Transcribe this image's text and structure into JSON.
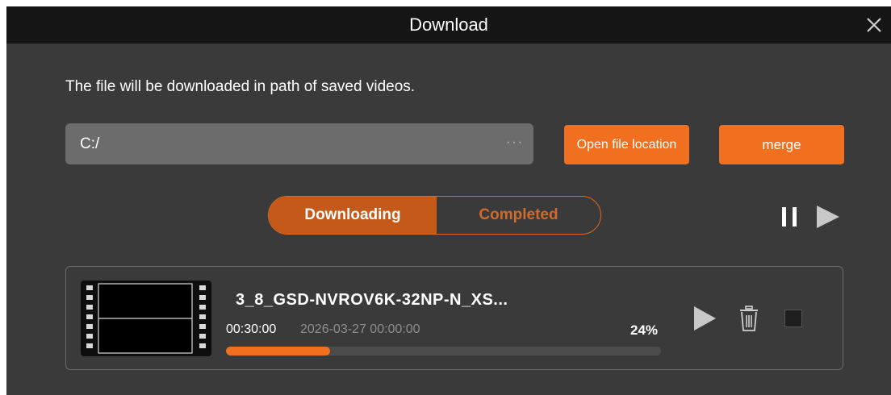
{
  "window": {
    "title": "Download",
    "close_icon": "close-icon"
  },
  "info_text": "The file will be downloaded in path of saved videos.",
  "path": {
    "value": "C:/",
    "browse_icon": "more-dots-icon"
  },
  "buttons": {
    "open_location": "Open file location",
    "merge": "merge"
  },
  "tabs": [
    {
      "label": "Downloading",
      "active": true
    },
    {
      "label": "Completed",
      "active": false
    }
  ],
  "controls": {
    "pause_all_icon": "pause-icon",
    "start_all_icon": "play-icon"
  },
  "download_item": {
    "filename": "3_8_GSD-NVROV6K-32NP-N_XS...",
    "duration": "00:30:00",
    "datetime": "2026-03-27 00:00:00",
    "progress_text": "24%",
    "progress": 0.24,
    "thumbnail_icon": "film-strip-icon",
    "play_icon": "play-icon",
    "delete_icon": "trash-icon",
    "select_checked": false
  },
  "colors": {
    "accent": "#f07020",
    "tab_active": "#c4591a",
    "background": "#3a3a3a",
    "titlebar": "#151515"
  }
}
